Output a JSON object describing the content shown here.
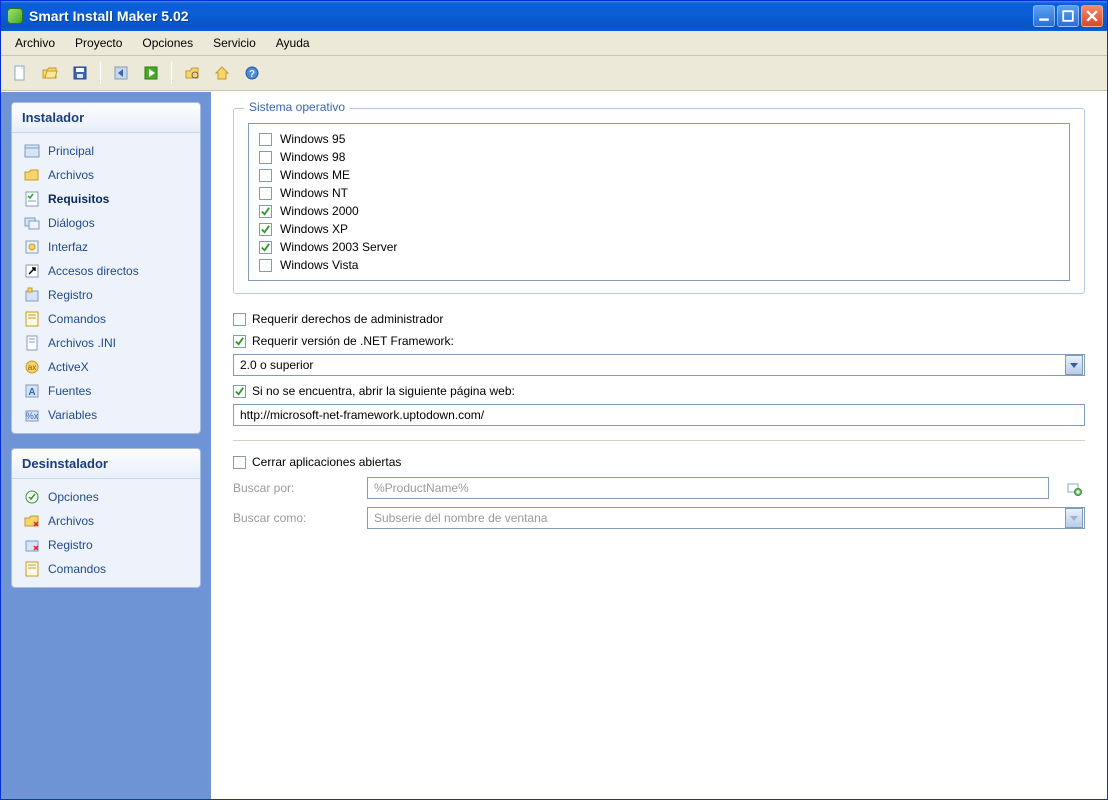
{
  "window": {
    "title": "Smart Install Maker 5.02"
  },
  "menu": {
    "items": [
      {
        "label": "Archivo"
      },
      {
        "label": "Proyecto"
      },
      {
        "label": "Opciones"
      },
      {
        "label": "Servicio"
      },
      {
        "label": "Ayuda"
      }
    ]
  },
  "toolbar": {
    "buttons": [
      {
        "name": "new-button",
        "icon": "file-new-icon"
      },
      {
        "name": "open-button",
        "icon": "folder-open-icon"
      },
      {
        "name": "save-button",
        "icon": "save-icon"
      },
      {
        "sep": true
      },
      {
        "name": "prev-button",
        "icon": "arrow-prev-icon"
      },
      {
        "name": "run-button",
        "icon": "play-icon"
      },
      {
        "sep": true
      },
      {
        "name": "settings-button",
        "icon": "settings-icon"
      },
      {
        "name": "home-button",
        "icon": "home-icon"
      },
      {
        "name": "help-button",
        "icon": "help-icon"
      }
    ]
  },
  "sidebar": {
    "sections": [
      {
        "title": "Instalador",
        "items": [
          {
            "label": "Principal",
            "icon": "form-icon",
            "selected": false
          },
          {
            "label": "Archivos",
            "icon": "folder-icon",
            "selected": false
          },
          {
            "label": "Requisitos",
            "icon": "checklist-icon",
            "selected": true
          },
          {
            "label": "Diálogos",
            "icon": "dialogs-icon",
            "selected": false
          },
          {
            "label": "Interfaz",
            "icon": "interface-icon",
            "selected": false
          },
          {
            "label": "Accesos directos",
            "icon": "shortcut-icon",
            "selected": false
          },
          {
            "label": "Registro",
            "icon": "registry-icon",
            "selected": false
          },
          {
            "label": "Comandos",
            "icon": "commands-icon",
            "selected": false
          },
          {
            "label": "Archivos .INI",
            "icon": "ini-icon",
            "selected": false
          },
          {
            "label": "ActiveX",
            "icon": "activex-icon",
            "selected": false
          },
          {
            "label": "Fuentes",
            "icon": "fonts-icon",
            "selected": false
          },
          {
            "label": "Variables",
            "icon": "variables-icon",
            "selected": false
          }
        ]
      },
      {
        "title": "Desinstalador",
        "items": [
          {
            "label": "Opciones",
            "icon": "options-icon",
            "selected": false
          },
          {
            "label": "Archivos",
            "icon": "folder-del-icon",
            "selected": false
          },
          {
            "label": "Registro",
            "icon": "registry-del-icon",
            "selected": false
          },
          {
            "label": "Comandos",
            "icon": "commands-icon",
            "selected": false
          }
        ]
      }
    ]
  },
  "content": {
    "os_group": {
      "legend": "Sistema operativo",
      "items": [
        {
          "label": "Windows 95",
          "checked": false
        },
        {
          "label": "Windows 98",
          "checked": false
        },
        {
          "label": "Windows ME",
          "checked": false
        },
        {
          "label": "Windows NT",
          "checked": false
        },
        {
          "label": "Windows 2000",
          "checked": true
        },
        {
          "label": "Windows XP",
          "checked": true
        },
        {
          "label": "Windows 2003 Server",
          "checked": true
        },
        {
          "label": "Windows Vista",
          "checked": false
        }
      ]
    },
    "admin_rights": {
      "label": "Requerir derechos de administrador",
      "checked": false
    },
    "netfx": {
      "label": "Requerir versión de .NET Framework:",
      "checked": true,
      "combo_value": "2.0 o superior"
    },
    "openweb": {
      "label": "Si no se encuentra, abrir la siguiente página web:",
      "checked": true,
      "url": "http://microsoft-net-framework.uptodown.com/"
    },
    "closeapps": {
      "label": "Cerrar aplicaciones abiertas",
      "checked": false,
      "search_by_label": "Buscar por:",
      "search_by_value": "%ProductName%",
      "search_as_label": "Buscar como:",
      "search_as_value": "Subserie del nombre de ventana"
    }
  }
}
